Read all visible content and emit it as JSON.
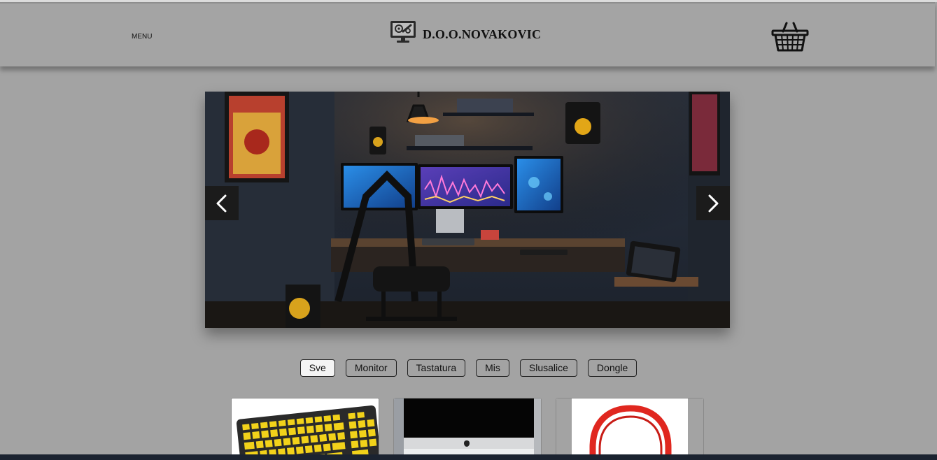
{
  "header": {
    "menu_label": "MENU",
    "brand_name": "D.O.O.NOVAKOVIC",
    "logo_icon": "computer-gear-icon",
    "cart_icon": "basket-icon"
  },
  "carousel": {
    "image": "gaming-desk-setup-photo",
    "prev_icon": "chevron-left-icon",
    "next_icon": "chevron-right-icon"
  },
  "filters": [
    {
      "label": "Sve",
      "active": true
    },
    {
      "label": "Monitor",
      "active": false
    },
    {
      "label": "Tastatura",
      "active": false
    },
    {
      "label": "Mis",
      "active": false
    },
    {
      "label": "Slusalice",
      "active": false
    },
    {
      "label": "Dongle",
      "active": false
    }
  ],
  "products": [
    {
      "image": "yellow-keyboard-photo"
    },
    {
      "image": "imac-monitor-photo"
    },
    {
      "image": "red-headphones-photo"
    }
  ],
  "colors": {
    "background": "#a3a3a3",
    "header": "#a4a4a4",
    "active_filter": "#f4f4f4",
    "carousel_button": "#1b1b1b"
  }
}
